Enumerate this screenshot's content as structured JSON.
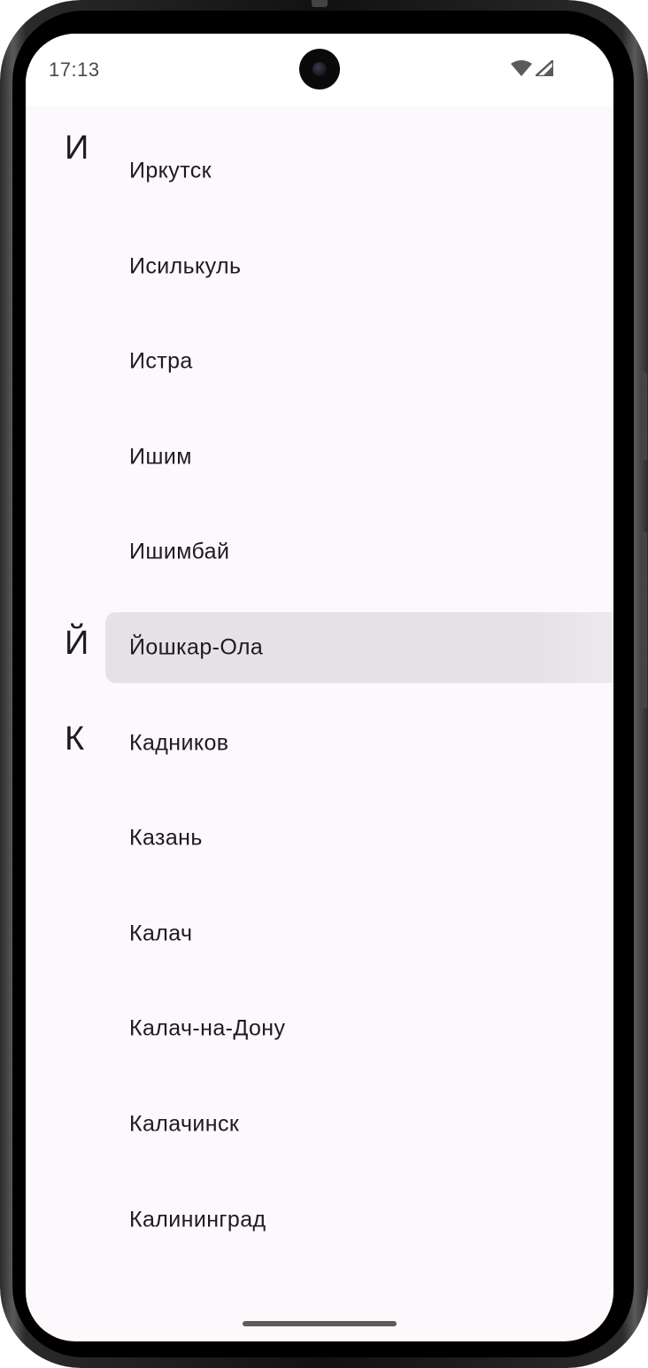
{
  "status_bar": {
    "time": "17:13",
    "icons": [
      "wifi-icon",
      "signal-icon"
    ]
  },
  "list": {
    "sections": [
      {
        "letter": "И",
        "items": [
          "Иркутск",
          "Исилькуль",
          "Истра",
          "Ишим",
          "Ишимбай"
        ]
      },
      {
        "letter": "Й",
        "items": [
          "Йошкар-Ола"
        ]
      },
      {
        "letter": "К",
        "items": [
          "Кадников",
          "Казань",
          "Калач",
          "Калач-на-Дону",
          "Калачинск",
          "Калининград"
        ]
      }
    ],
    "highlighted_item": "Йошкар-Ола"
  },
  "colors": {
    "background": "#fcf8fc",
    "highlight": "#e5e1e6",
    "text": "#1c1b1f"
  }
}
